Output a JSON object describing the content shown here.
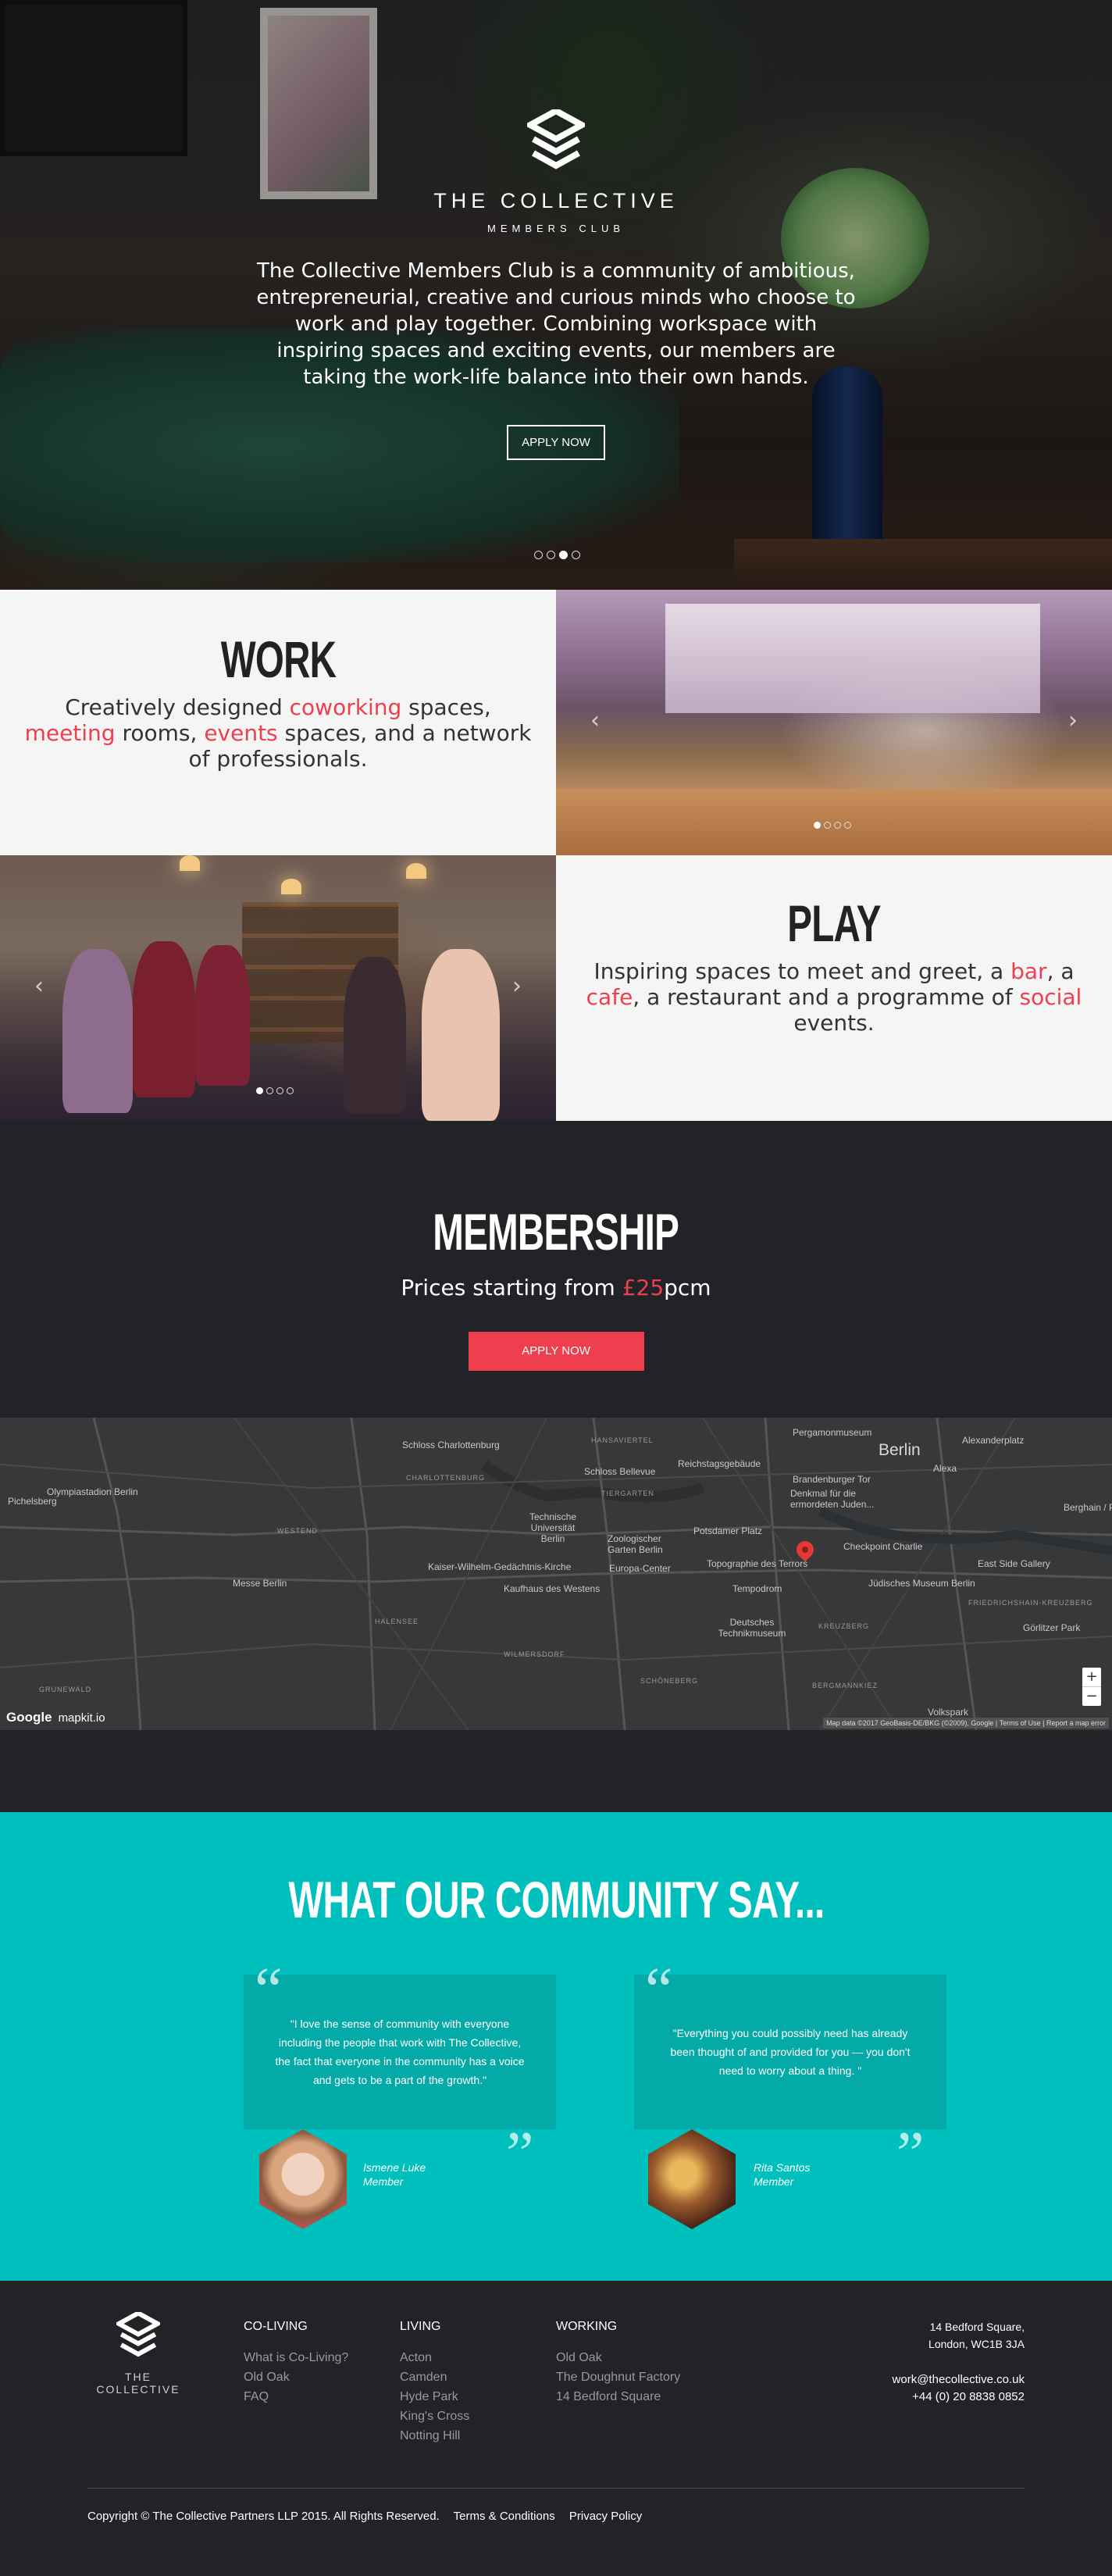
{
  "hero": {
    "brand_name": "THE COLLECTIVE",
    "brand_sub": "MEMBERS CLUB",
    "description": "The Collective Members Club is a community of ambitious, entrepreneurial, creative and curious minds who choose to work and play together. Combining workspace with inspiring spaces and exciting events, our members are taking the work-life balance into their own hands.",
    "apply_label": "APPLY NOW",
    "slide_count": 4,
    "active_slide": 3
  },
  "work": {
    "title": "WORK",
    "desc_parts": [
      "Creatively designed ",
      "coworking",
      " spaces, ",
      "meeting",
      " rooms, ",
      "events",
      " spaces, and a network of professionals."
    ]
  },
  "play": {
    "title": "PLAY",
    "desc_parts": [
      "Inspiring spaces to meet and greet, a ",
      "bar",
      ", a ",
      "cafe",
      ", a restaurant and a programme of ",
      "social",
      " events."
    ]
  },
  "membership": {
    "title": "MEMBERSHIP",
    "price_prefix": "Prices starting from ",
    "price": "£25",
    "price_suffix": "pcm",
    "apply_label": "APPLY NOW"
  },
  "map": {
    "labels": {
      "schloss_charlottenburg": "Schloss Charlottenburg",
      "hansaviertel": "HANSAVIERTEL",
      "pergamonmuseum": "Pergamonmuseum",
      "alexanderplatz": "Alexanderplatz",
      "berlin": "Berlin",
      "alexa": "Alexa",
      "schloss_bellevue": "Schloss Bellevue",
      "reichstagsgebaude": "Reichstagsgebäude",
      "brandenburger_tor": "Brandenburger Tor",
      "denkmal": "Denkmal für die ermordeten Juden...",
      "olympiastadion": "Olympiastadion Berlin",
      "pichelsberg": "Pichelsberg",
      "charlottenburg": "CHARLOTTENBURG",
      "tiergarten": "TIERGARTEN",
      "westend": "WESTEND",
      "tu_berlin": "Technische Universität Berlin",
      "zoologischer_garten": "Zoologischer Garten Berlin",
      "potsdamer_platz": "Potsdamer Platz",
      "checkpoint_charlie": "Checkpoint Charlie",
      "berghain": "Berghain / Pa",
      "messe_berlin": "Messe Berlin",
      "kaiser_wilhelm": "Kaiser-Wilhelm-Gedächtnis-Kirche",
      "europa_center": "Europa-Center",
      "topographie": "Topographie des Terrors",
      "east_side_gallery": "East Side Gallery",
      "kaufhaus": "Kaufhaus des Westens",
      "tempodrom": "Tempodrom",
      "judisches_museum": "Jüdisches Museum Berlin",
      "friedrichshain": "FRIEDRICHSHAIN-KREUZBERG",
      "halensee": "HALENSEE",
      "deutsches_technikmuseum": "Deutsches Technikmuseum",
      "kreuzberg": "KREUZBERG",
      "gorlitzer_park": "Görlitzer Park",
      "wilmersdorf": "WILMERSDORF",
      "grunewald": "GRUNEWALD",
      "schoneberg": "SCHÖNEBERG",
      "bergmannkiez": "BERGMANNKIEZ",
      "volkspark": "Volkspark"
    },
    "google": "Google",
    "mapkit": "mapkit.io",
    "zoom_in": "+",
    "zoom_out": "−",
    "attribution": "Map data ©2017 GeoBasis-DE/BKG (©2009), Google | Terms of Use | Report a map error"
  },
  "testimonials": {
    "title": "WHAT OUR COMMUNITY SAY...",
    "items": [
      {
        "quote": "\"I love the sense of community with everyone including the people that work with The Collective, the fact that everyone in the community has a voice and gets to be a part of the growth.\"",
        "name": "Ismene Luke",
        "role": "Member"
      },
      {
        "quote": "\"Everything you could possibly need has already been thought of and provided for you — you don't need to worry about a thing. \"",
        "name": "Rita Santos",
        "role": "Member"
      }
    ]
  },
  "footer": {
    "logo_name": "THE COLLECTIVE",
    "columns": [
      {
        "title": "CO-LIVING",
        "links": [
          "What is Co-Living?",
          "Old Oak",
          "FAQ"
        ]
      },
      {
        "title": "LIVING",
        "links": [
          "Acton",
          "Camden",
          "Hyde Park",
          "King's Cross",
          "Notting Hill"
        ]
      },
      {
        "title": "WORKING",
        "links": [
          "Old Oak",
          "The Doughnut Factory",
          "14 Bedford Square"
        ]
      }
    ],
    "address_line1": "14 Bedford Square,",
    "address_line2": "London, WC1B 3JA",
    "email": "work@thecollective.co.uk",
    "phone": "+44 (0) 20 8838 0852",
    "copyright": "Copyright © The Collective Partners LLP 2015. All Rights Reserved.",
    "terms": "Terms & Conditions",
    "privacy": "Privacy Policy"
  },
  "colors": {
    "accent_red": "#ef3f4f",
    "teal": "#00c0be",
    "dark": "#222326"
  }
}
